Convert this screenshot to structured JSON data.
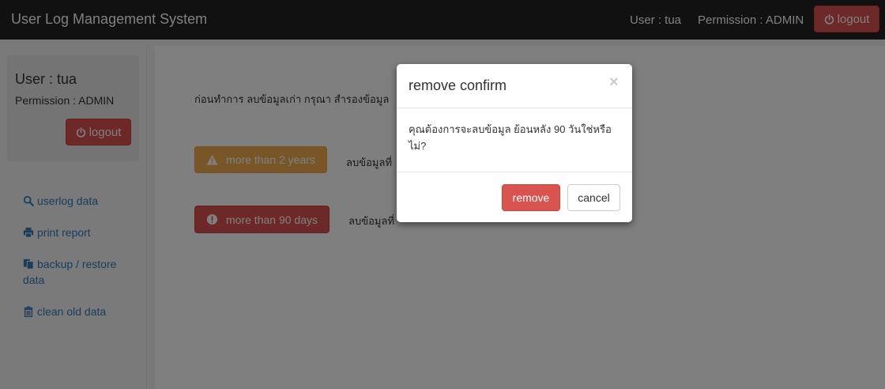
{
  "navbar": {
    "brand": "User Log Management System",
    "user": "User : tua",
    "permission": "Permission : ADMIN",
    "logout_label": "logout"
  },
  "sidebar": {
    "user": "User : tua",
    "permission": "Permission : ADMIN",
    "logout_label": "logout",
    "links": [
      {
        "label": "userlog data",
        "icon": "search-icon"
      },
      {
        "label": "print report",
        "icon": "print-icon"
      },
      {
        "label": "backup / restore data",
        "icon": "copy-icon"
      },
      {
        "label": "clean old data",
        "icon": "trash-icon"
      }
    ]
  },
  "main": {
    "intro": "ก่อนทำการ ลบข้อมูลเก่า กรุณา สำรองข้อมูล",
    "actions": [
      {
        "label": "more than 2 years",
        "icon": "warning-icon",
        "description": "ลบข้อมูลที่"
      },
      {
        "label": "more than 90 days",
        "icon": "exclamation-icon",
        "description": "ลบข้อมูลที่"
      }
    ]
  },
  "modal": {
    "title": "remove confirm",
    "close": "×",
    "body": "คุณต้องการจะลบข้อมูล ย้อนหลัง 90 วันใช่หรือไม่?",
    "remove_label": "remove",
    "cancel_label": "cancel"
  },
  "colors": {
    "navbar": "#222222",
    "danger": "#d9534f",
    "warning": "#f0ad4e",
    "link": "#337ab7"
  }
}
